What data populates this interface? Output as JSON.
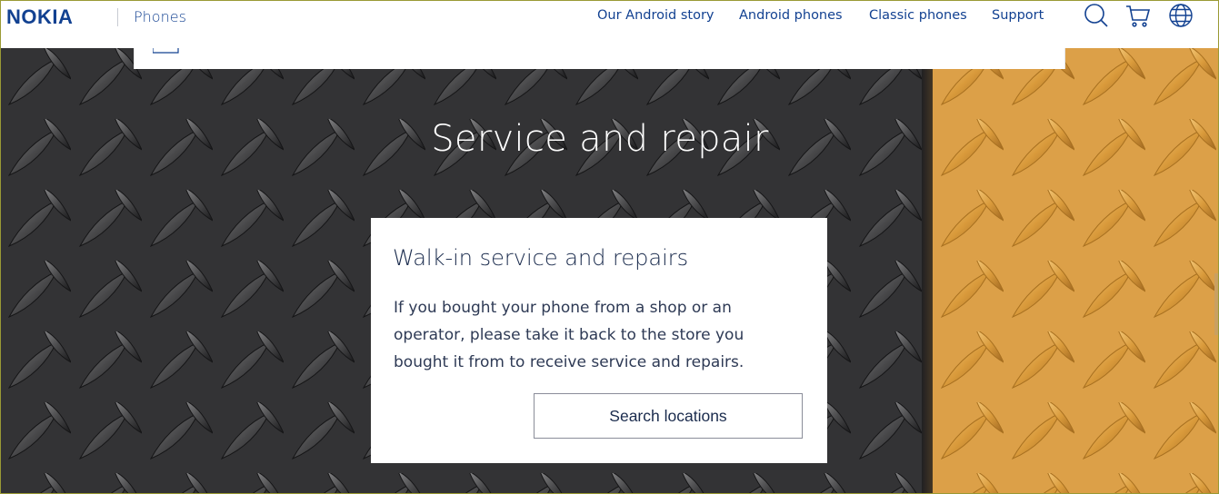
{
  "brand": {
    "logo": "NOKIA",
    "section": "Phones",
    "color": "#124191"
  },
  "nav": {
    "items": [
      {
        "label": "Our Android story"
      },
      {
        "label": "Android phones"
      },
      {
        "label": "Classic phones"
      },
      {
        "label": "Support"
      }
    ],
    "icons": [
      "search-icon",
      "cart-icon",
      "globe-icon"
    ]
  },
  "hero": {
    "title": "Service and repair",
    "card": {
      "title": "Walk-in service and repairs",
      "body": "If you bought your phone from a shop or an operator, please take it back to the store you bought it from to receive service and repairs.",
      "button_label": "Search locations"
    }
  }
}
